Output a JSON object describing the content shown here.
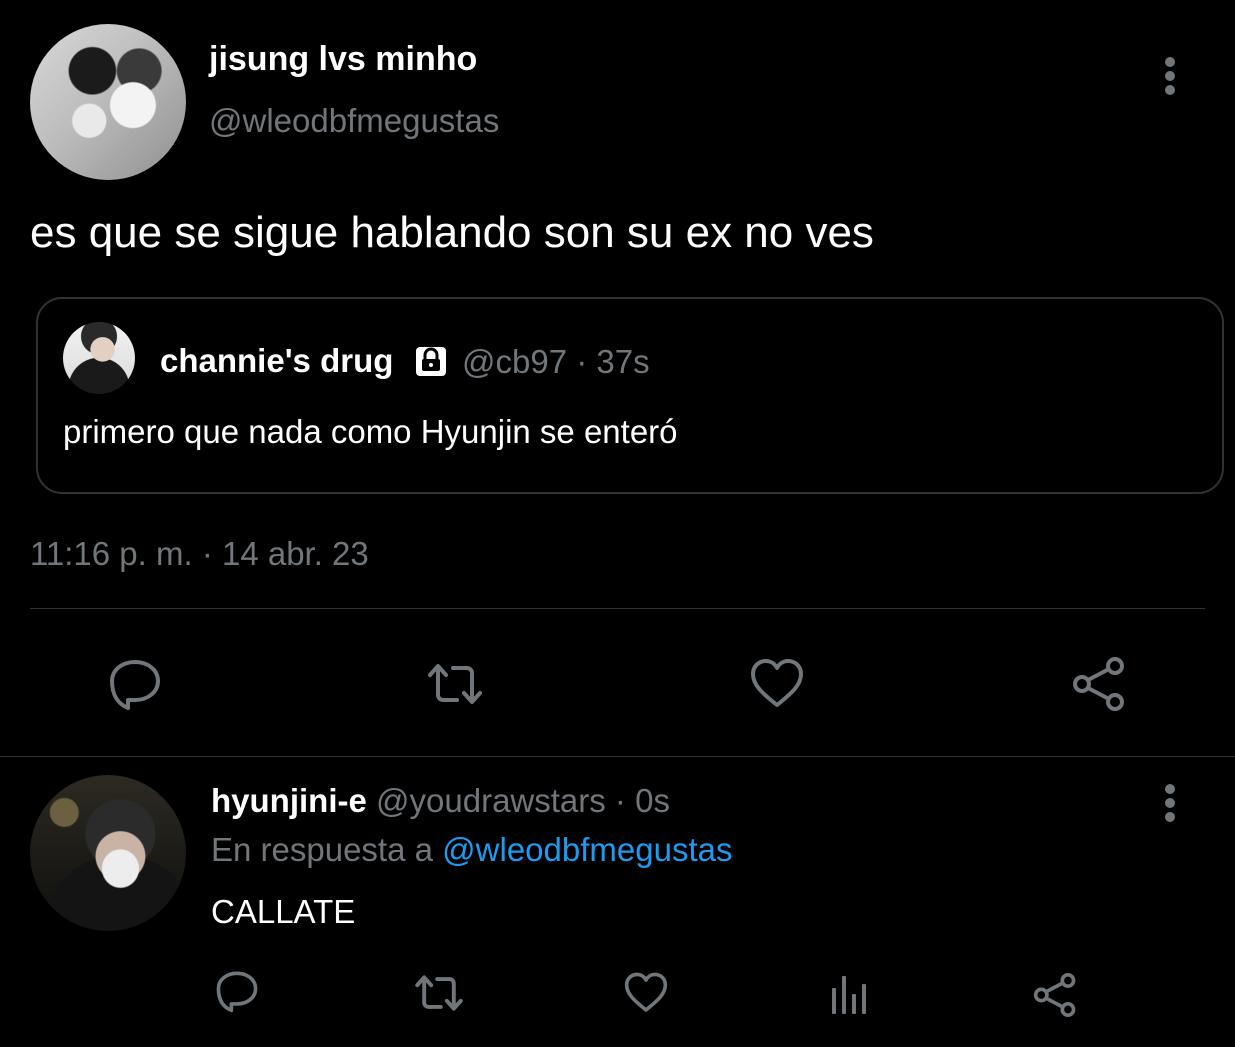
{
  "colors": {
    "background": "#000000",
    "text_primary": "#ffffff",
    "text_secondary": "#71767b",
    "link": "#1d9bf0",
    "border": "#2f3336"
  },
  "main_tweet": {
    "display_name": "jisung lvs minho",
    "handle": "@wleodbfmegustas",
    "text": "es que se sigue hablando son su ex no ves",
    "timestamp": "11:16 p. m. · 14 abr. 23",
    "quoted_tweet": {
      "display_name": "channie's drug",
      "protected_icon": "lock-icon",
      "handle_time": "@cb97 · 37s",
      "text": "primero que nada como Hyunjin se enteró"
    },
    "actions": [
      "reply-icon",
      "retweet-icon",
      "like-icon",
      "share-icon"
    ],
    "more_icon": "more-vertical-icon"
  },
  "reply_tweet": {
    "display_name": "hyunjini-e",
    "handle_time": "@youdrawstars · 0s",
    "context_prefix": "En respuesta a",
    "context_mention": "@wleodbfmegustas",
    "text": "CALLATE",
    "actions": [
      "reply-icon",
      "retweet-icon",
      "like-icon",
      "analytics-icon",
      "share-icon"
    ],
    "more_icon": "more-vertical-icon"
  }
}
